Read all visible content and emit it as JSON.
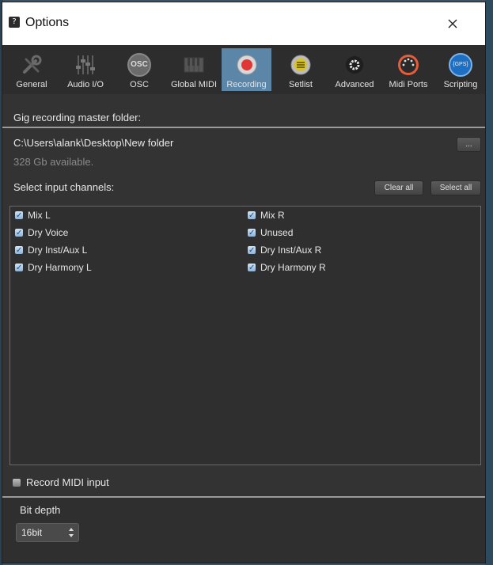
{
  "window": {
    "title": "Options",
    "app_icon_glyph": "?"
  },
  "toolbar": {
    "items": [
      {
        "label": "General",
        "icon": "wrench-screwdriver-icon"
      },
      {
        "label": "Audio I/O",
        "icon": "faders-icon"
      },
      {
        "label": "OSC",
        "icon": "osc-icon",
        "icon_text": "OSC"
      },
      {
        "label": "Global MIDI",
        "icon": "piano-keys-icon"
      },
      {
        "label": "Recording",
        "icon": "record-icon"
      },
      {
        "label": "Setlist",
        "icon": "setlist-icon"
      },
      {
        "label": "Advanced",
        "icon": "gear-icon"
      },
      {
        "label": "Midi Ports",
        "icon": "midi-port-icon"
      },
      {
        "label": "Scripting",
        "icon": "gps-script-icon",
        "icon_text": "{GPS}"
      }
    ],
    "active": "Recording",
    "active_color": "#5b86a8"
  },
  "recording": {
    "master_folder_label": "Gig recording master folder:",
    "path": "C:\\Users\\alank\\Desktop\\New folder",
    "browse_label": "...",
    "available": "328 Gb available.",
    "select_channels_label": "Select input channels:",
    "clear_all_label": "Clear all",
    "select_all_label": "Select all",
    "channels_left": [
      {
        "label": "Mix L",
        "checked": true
      },
      {
        "label": "Dry Voice",
        "checked": true
      },
      {
        "label": "Dry Inst/Aux L",
        "checked": true
      },
      {
        "label": "Dry Harmony L",
        "checked": true
      }
    ],
    "channels_right": [
      {
        "label": "Mix R",
        "checked": true
      },
      {
        "label": "Unused",
        "checked": true
      },
      {
        "label": "Dry Inst/Aux R",
        "checked": true
      },
      {
        "label": "Dry Harmony R",
        "checked": true
      }
    ],
    "checkmark_glyph": "✓",
    "record_midi_label": "Record MIDI input",
    "record_midi_checked": false,
    "bit_depth_label": "Bit depth",
    "bit_depth_value": "16bit"
  }
}
